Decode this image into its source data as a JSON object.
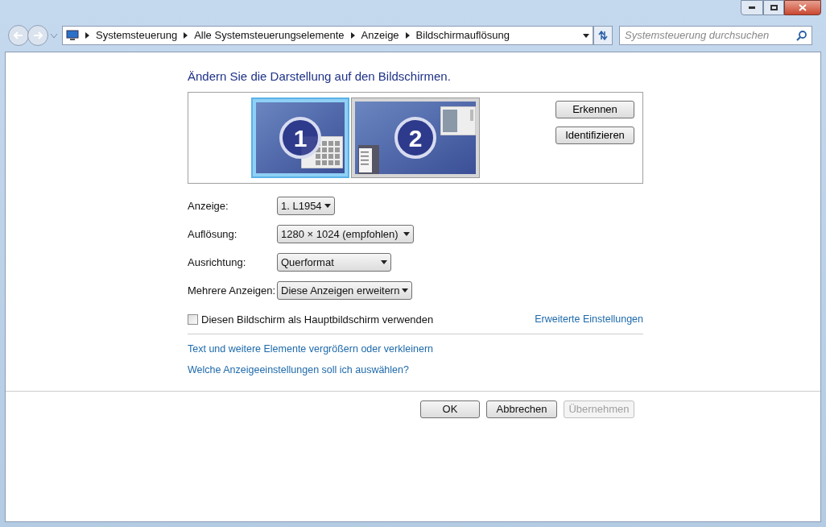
{
  "breadcrumbs": [
    "Systemsteuerung",
    "Alle Systemsteuerungselemente",
    "Anzeige",
    "Bildschirmauflösung"
  ],
  "search": {
    "placeholder": "Systemsteuerung durchsuchen"
  },
  "heading": "Ändern Sie die Darstellung auf den Bildschirmen.",
  "monitors": [
    {
      "label": "1",
      "selected": true
    },
    {
      "label": "2",
      "selected": false
    }
  ],
  "monitor_buttons": [
    "Erkennen",
    "Identifizieren"
  ],
  "settings": [
    {
      "label": "Anzeige:",
      "value": "1. L1954"
    },
    {
      "label": "Auflösung:",
      "value": "1280 × 1024 (empfohlen)"
    },
    {
      "label": "Ausrichtung:",
      "value": "Querformat"
    },
    {
      "label": "Mehrere Anzeigen:",
      "value": "Diese Anzeigen erweitern"
    }
  ],
  "primary_checkbox": {
    "label": "Diesen Bildschirm als Hauptbildschirm verwenden",
    "checked": false
  },
  "advanced_link": "Erweiterte Einstellungen",
  "links": [
    "Text und weitere Elemente vergrößern oder verkleinern",
    "Welche Anzeigeeinstellungen soll ich auswählen?"
  ],
  "buttons": [
    {
      "label": "OK",
      "disabled": false
    },
    {
      "label": "Abbrechen",
      "disabled": false
    },
    {
      "label": "Übernehmen",
      "disabled": true
    }
  ]
}
